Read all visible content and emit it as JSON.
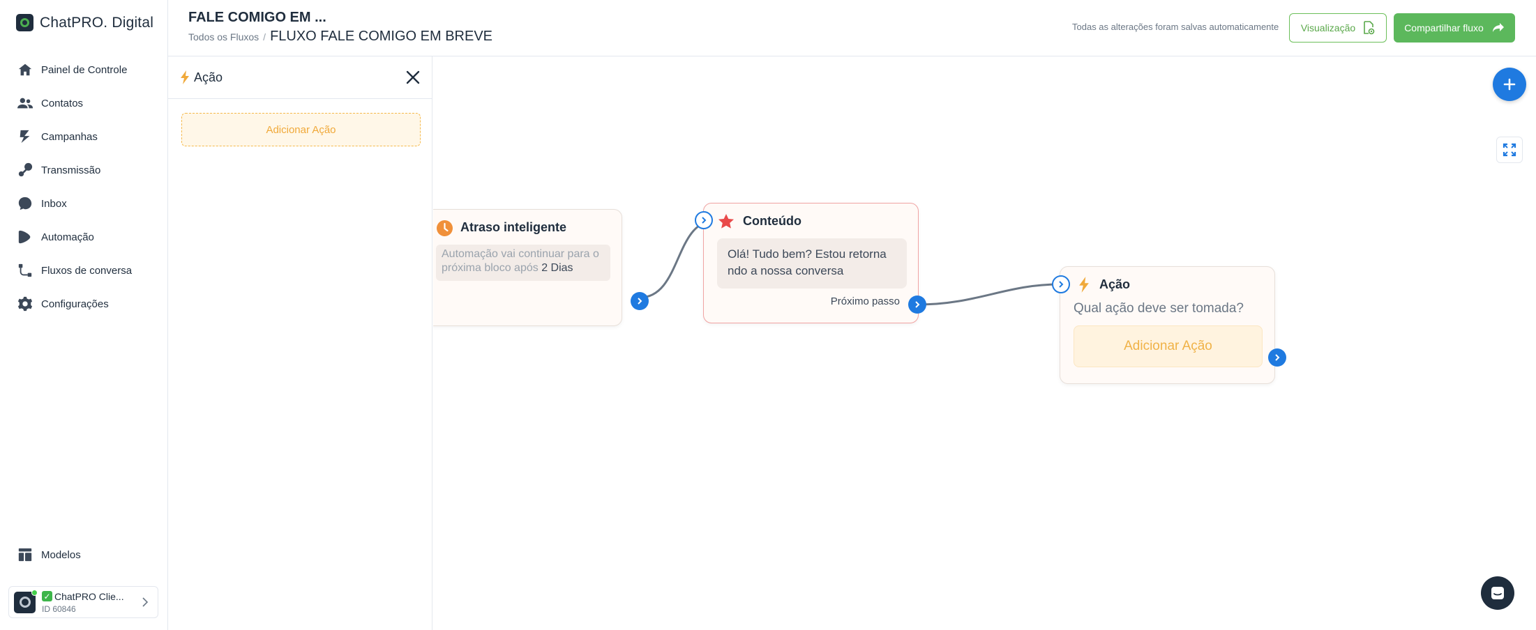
{
  "brand": {
    "name": "ChatPRO. Digital"
  },
  "sidebar": {
    "items": [
      {
        "label": "Painel de Controle",
        "icon": "home-icon"
      },
      {
        "label": "Contatos",
        "icon": "users-icon"
      },
      {
        "label": "Campanhas",
        "icon": "megaphone-icon"
      },
      {
        "label": "Transmissão",
        "icon": "broadcast-icon"
      },
      {
        "label": "Inbox",
        "icon": "chat-bubble-icon"
      },
      {
        "label": "Automação",
        "icon": "automation-icon"
      },
      {
        "label": "Fluxos de conversa",
        "icon": "flow-icon"
      },
      {
        "label": "Configurações",
        "icon": "gear-icon"
      }
    ],
    "bottom": {
      "label": "Modelos",
      "icon": "templates-icon"
    },
    "account": {
      "name": "ChatPRO Clie...",
      "id": "ID 60846",
      "status": "online"
    }
  },
  "header": {
    "title": "FALE COMIGO EM ...",
    "breadcrumb_root": "Todos os Fluxos",
    "breadcrumb_sep": "/",
    "breadcrumb_current": "FLUXO FALE COMIGO EM BREVE",
    "save_status": "Todas as alterações foram salvas automaticamente",
    "preview_label": "Visualização",
    "share_label": "Compartilhar fluxo"
  },
  "panel": {
    "title": "Ação",
    "add_action": "Adicionar Ação"
  },
  "canvas": {
    "delay_node": {
      "title": "Atraso inteligente",
      "text": "Automação vai continuar para o próxima bloco após",
      "duration": "2 Dias"
    },
    "content_node": {
      "title": "Conteúdo",
      "message": "Olá! Tudo bem? Estou retorna ndo a nossa conversa",
      "next_step": "Próximo passo"
    },
    "action_node": {
      "title": "Ação",
      "question": "Qual ação deve ser tomada?",
      "add_action": "Adicionar Ação"
    }
  },
  "colors": {
    "accent_blue": "#1f7ae0",
    "green": "#5cb85c",
    "warning": "#f0b247",
    "content_border": "#f0a3a3"
  }
}
